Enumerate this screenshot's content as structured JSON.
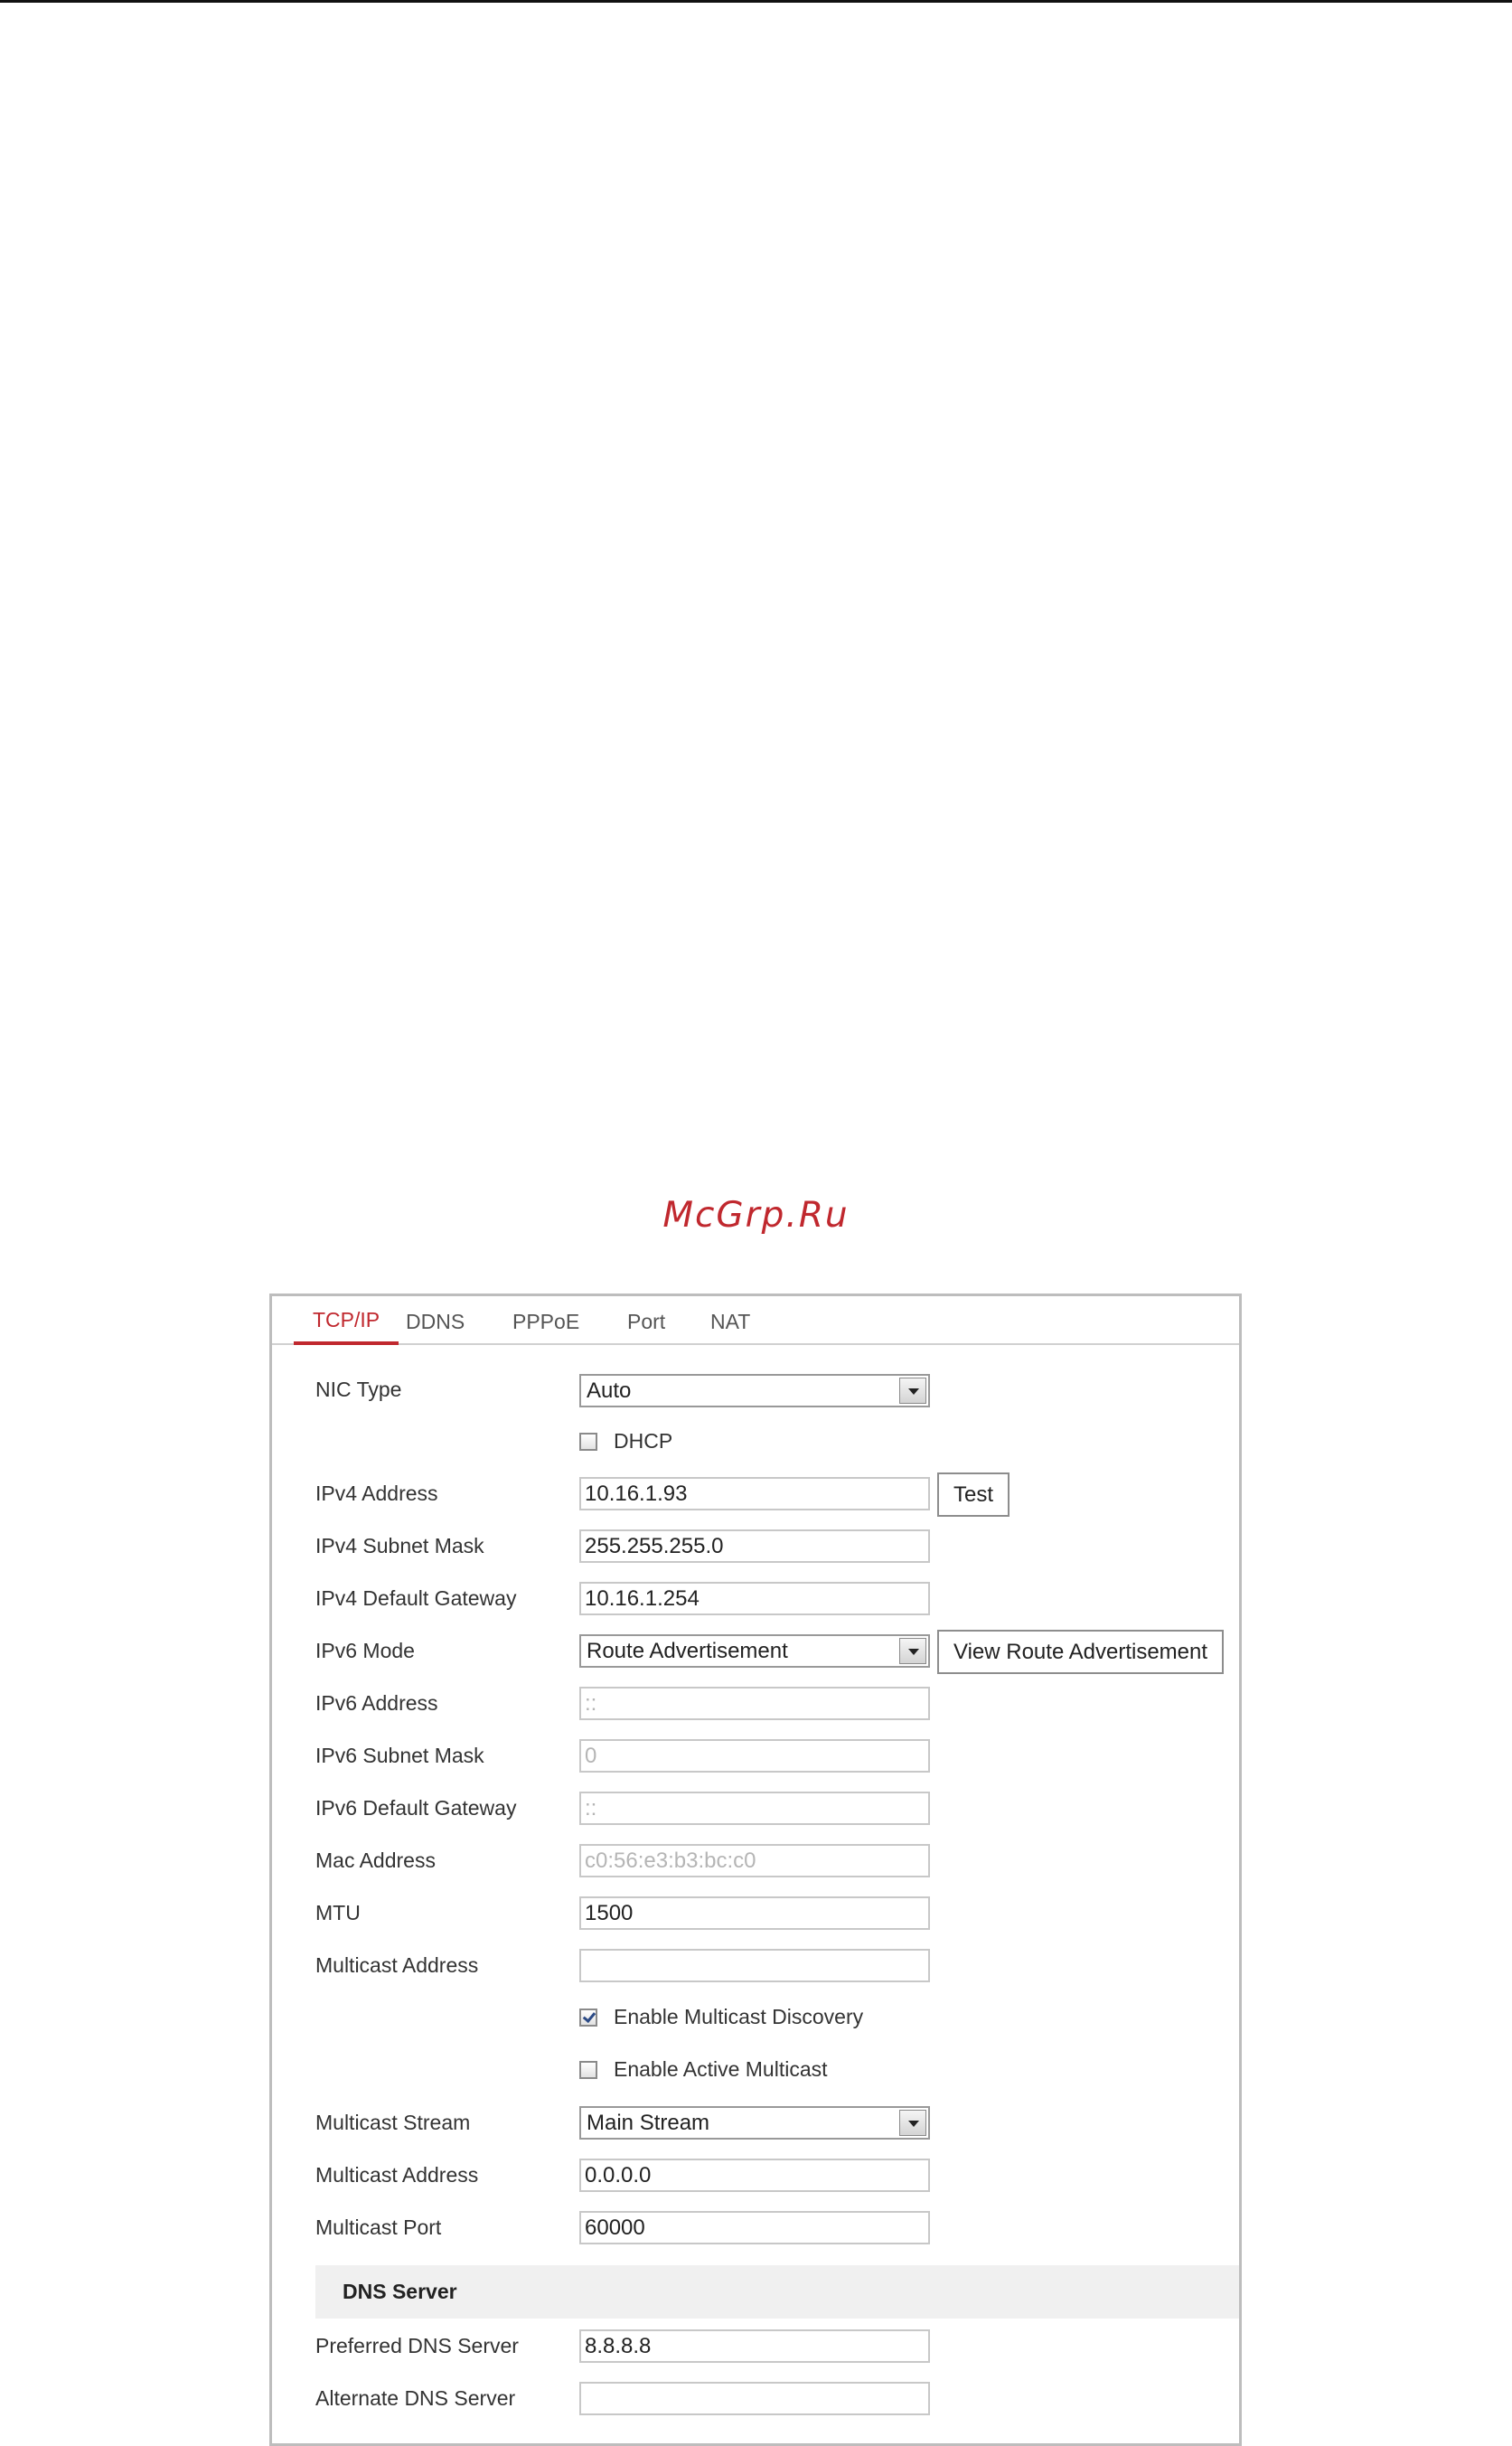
{
  "watermark": "McGrp.Ru",
  "tabs": [
    {
      "label": "TCP/IP",
      "active": true
    },
    {
      "label": "DDNS",
      "active": false
    },
    {
      "label": "PPPoE",
      "active": false
    },
    {
      "label": "Port",
      "active": false
    },
    {
      "label": "NAT",
      "active": false
    }
  ],
  "form": {
    "nic_type": {
      "label": "NIC Type",
      "value": "Auto"
    },
    "dhcp": {
      "label": "DHCP",
      "checked": false
    },
    "ipv4_address": {
      "label": "IPv4 Address",
      "value": "10.16.1.93",
      "button": "Test"
    },
    "ipv4_subnet_mask": {
      "label": "IPv4 Subnet Mask",
      "value": "255.255.255.0"
    },
    "ipv4_default_gateway": {
      "label": "IPv4 Default Gateway",
      "value": "10.16.1.254"
    },
    "ipv6_mode": {
      "label": "IPv6 Mode",
      "value": "Route Advertisement",
      "button": "View Route Advertisement"
    },
    "ipv6_address": {
      "label": "IPv6 Address",
      "value": "::"
    },
    "ipv6_subnet_mask": {
      "label": "IPv6 Subnet Mask",
      "value": "0"
    },
    "ipv6_default_gateway": {
      "label": "IPv6 Default Gateway",
      "value": "::"
    },
    "mac_address": {
      "label": "Mac Address",
      "value": "c0:56:e3:b3:bc:c0"
    },
    "mtu": {
      "label": "MTU",
      "value": "1500"
    },
    "multicast_address": {
      "label": "Multicast Address",
      "value": ""
    },
    "enable_multicast_discovery": {
      "label": "Enable Multicast Discovery",
      "checked": true
    },
    "enable_active_multicast": {
      "label": "Enable Active Multicast",
      "checked": false
    },
    "multicast_stream": {
      "label": "Multicast Stream",
      "value": "Main Stream"
    },
    "multicast_address_2": {
      "label": "Multicast Address",
      "value": "0.0.0.0"
    },
    "multicast_port": {
      "label": "Multicast Port",
      "value": "60000"
    }
  },
  "dns": {
    "section_title": "DNS Server",
    "preferred": {
      "label": "Preferred DNS Server",
      "value": "8.8.8.8"
    },
    "alternate": {
      "label": "Alternate DNS Server",
      "value": ""
    }
  }
}
